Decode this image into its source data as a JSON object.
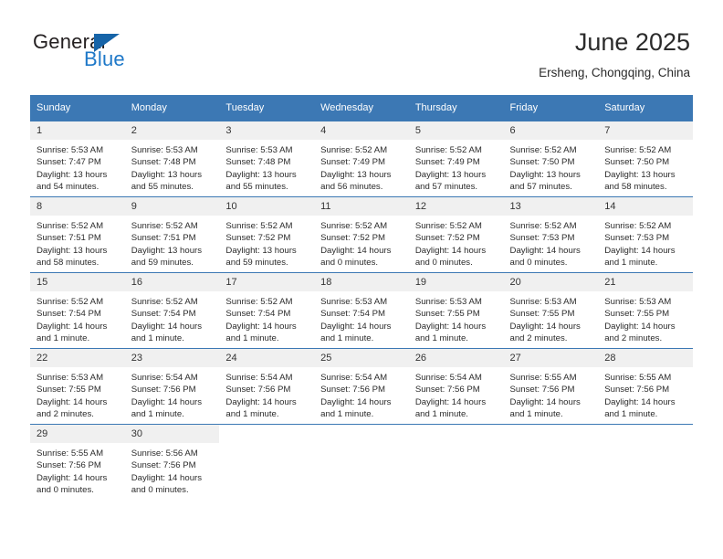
{
  "logo": {
    "word1": "General",
    "word2": "Blue",
    "triangle_color": "#1664a8",
    "word2_color": "#1e78c8"
  },
  "header": {
    "title": "June 2025",
    "subtitle": "Ersheng, Chongqing, China"
  },
  "theme": {
    "header_blue": "#3c78b4",
    "daynum_bg": "#f0f0f0",
    "text": "#2b2b2b"
  },
  "weekday_headers": [
    "Sunday",
    "Monday",
    "Tuesday",
    "Wednesday",
    "Thursday",
    "Friday",
    "Saturday"
  ],
  "weeks": [
    [
      {
        "day": "1",
        "sunrise": "Sunrise: 5:53 AM",
        "sunset": "Sunset: 7:47 PM",
        "daylight1": "Daylight: 13 hours",
        "daylight2": "and 54 minutes."
      },
      {
        "day": "2",
        "sunrise": "Sunrise: 5:53 AM",
        "sunset": "Sunset: 7:48 PM",
        "daylight1": "Daylight: 13 hours",
        "daylight2": "and 55 minutes."
      },
      {
        "day": "3",
        "sunrise": "Sunrise: 5:53 AM",
        "sunset": "Sunset: 7:48 PM",
        "daylight1": "Daylight: 13 hours",
        "daylight2": "and 55 minutes."
      },
      {
        "day": "4",
        "sunrise": "Sunrise: 5:52 AM",
        "sunset": "Sunset: 7:49 PM",
        "daylight1": "Daylight: 13 hours",
        "daylight2": "and 56 minutes."
      },
      {
        "day": "5",
        "sunrise": "Sunrise: 5:52 AM",
        "sunset": "Sunset: 7:49 PM",
        "daylight1": "Daylight: 13 hours",
        "daylight2": "and 57 minutes."
      },
      {
        "day": "6",
        "sunrise": "Sunrise: 5:52 AM",
        "sunset": "Sunset: 7:50 PM",
        "daylight1": "Daylight: 13 hours",
        "daylight2": "and 57 minutes."
      },
      {
        "day": "7",
        "sunrise": "Sunrise: 5:52 AM",
        "sunset": "Sunset: 7:50 PM",
        "daylight1": "Daylight: 13 hours",
        "daylight2": "and 58 minutes."
      }
    ],
    [
      {
        "day": "8",
        "sunrise": "Sunrise: 5:52 AM",
        "sunset": "Sunset: 7:51 PM",
        "daylight1": "Daylight: 13 hours",
        "daylight2": "and 58 minutes."
      },
      {
        "day": "9",
        "sunrise": "Sunrise: 5:52 AM",
        "sunset": "Sunset: 7:51 PM",
        "daylight1": "Daylight: 13 hours",
        "daylight2": "and 59 minutes."
      },
      {
        "day": "10",
        "sunrise": "Sunrise: 5:52 AM",
        "sunset": "Sunset: 7:52 PM",
        "daylight1": "Daylight: 13 hours",
        "daylight2": "and 59 minutes."
      },
      {
        "day": "11",
        "sunrise": "Sunrise: 5:52 AM",
        "sunset": "Sunset: 7:52 PM",
        "daylight1": "Daylight: 14 hours",
        "daylight2": "and 0 minutes."
      },
      {
        "day": "12",
        "sunrise": "Sunrise: 5:52 AM",
        "sunset": "Sunset: 7:52 PM",
        "daylight1": "Daylight: 14 hours",
        "daylight2": "and 0 minutes."
      },
      {
        "day": "13",
        "sunrise": "Sunrise: 5:52 AM",
        "sunset": "Sunset: 7:53 PM",
        "daylight1": "Daylight: 14 hours",
        "daylight2": "and 0 minutes."
      },
      {
        "day": "14",
        "sunrise": "Sunrise: 5:52 AM",
        "sunset": "Sunset: 7:53 PM",
        "daylight1": "Daylight: 14 hours",
        "daylight2": "and 1 minute."
      }
    ],
    [
      {
        "day": "15",
        "sunrise": "Sunrise: 5:52 AM",
        "sunset": "Sunset: 7:54 PM",
        "daylight1": "Daylight: 14 hours",
        "daylight2": "and 1 minute."
      },
      {
        "day": "16",
        "sunrise": "Sunrise: 5:52 AM",
        "sunset": "Sunset: 7:54 PM",
        "daylight1": "Daylight: 14 hours",
        "daylight2": "and 1 minute."
      },
      {
        "day": "17",
        "sunrise": "Sunrise: 5:52 AM",
        "sunset": "Sunset: 7:54 PM",
        "daylight1": "Daylight: 14 hours",
        "daylight2": "and 1 minute."
      },
      {
        "day": "18",
        "sunrise": "Sunrise: 5:53 AM",
        "sunset": "Sunset: 7:54 PM",
        "daylight1": "Daylight: 14 hours",
        "daylight2": "and 1 minute."
      },
      {
        "day": "19",
        "sunrise": "Sunrise: 5:53 AM",
        "sunset": "Sunset: 7:55 PM",
        "daylight1": "Daylight: 14 hours",
        "daylight2": "and 1 minute."
      },
      {
        "day": "20",
        "sunrise": "Sunrise: 5:53 AM",
        "sunset": "Sunset: 7:55 PM",
        "daylight1": "Daylight: 14 hours",
        "daylight2": "and 2 minutes."
      },
      {
        "day": "21",
        "sunrise": "Sunrise: 5:53 AM",
        "sunset": "Sunset: 7:55 PM",
        "daylight1": "Daylight: 14 hours",
        "daylight2": "and 2 minutes."
      }
    ],
    [
      {
        "day": "22",
        "sunrise": "Sunrise: 5:53 AM",
        "sunset": "Sunset: 7:55 PM",
        "daylight1": "Daylight: 14 hours",
        "daylight2": "and 2 minutes."
      },
      {
        "day": "23",
        "sunrise": "Sunrise: 5:54 AM",
        "sunset": "Sunset: 7:56 PM",
        "daylight1": "Daylight: 14 hours",
        "daylight2": "and 1 minute."
      },
      {
        "day": "24",
        "sunrise": "Sunrise: 5:54 AM",
        "sunset": "Sunset: 7:56 PM",
        "daylight1": "Daylight: 14 hours",
        "daylight2": "and 1 minute."
      },
      {
        "day": "25",
        "sunrise": "Sunrise: 5:54 AM",
        "sunset": "Sunset: 7:56 PM",
        "daylight1": "Daylight: 14 hours",
        "daylight2": "and 1 minute."
      },
      {
        "day": "26",
        "sunrise": "Sunrise: 5:54 AM",
        "sunset": "Sunset: 7:56 PM",
        "daylight1": "Daylight: 14 hours",
        "daylight2": "and 1 minute."
      },
      {
        "day": "27",
        "sunrise": "Sunrise: 5:55 AM",
        "sunset": "Sunset: 7:56 PM",
        "daylight1": "Daylight: 14 hours",
        "daylight2": "and 1 minute."
      },
      {
        "day": "28",
        "sunrise": "Sunrise: 5:55 AM",
        "sunset": "Sunset: 7:56 PM",
        "daylight1": "Daylight: 14 hours",
        "daylight2": "and 1 minute."
      }
    ],
    [
      {
        "day": "29",
        "sunrise": "Sunrise: 5:55 AM",
        "sunset": "Sunset: 7:56 PM",
        "daylight1": "Daylight: 14 hours",
        "daylight2": "and 0 minutes."
      },
      {
        "day": "30",
        "sunrise": "Sunrise: 5:56 AM",
        "sunset": "Sunset: 7:56 PM",
        "daylight1": "Daylight: 14 hours",
        "daylight2": "and 0 minutes."
      },
      {
        "day": "",
        "sunrise": "",
        "sunset": "",
        "daylight1": "",
        "daylight2": ""
      },
      {
        "day": "",
        "sunrise": "",
        "sunset": "",
        "daylight1": "",
        "daylight2": ""
      },
      {
        "day": "",
        "sunrise": "",
        "sunset": "",
        "daylight1": "",
        "daylight2": ""
      },
      {
        "day": "",
        "sunrise": "",
        "sunset": "",
        "daylight1": "",
        "daylight2": ""
      },
      {
        "day": "",
        "sunrise": "",
        "sunset": "",
        "daylight1": "",
        "daylight2": ""
      }
    ]
  ]
}
